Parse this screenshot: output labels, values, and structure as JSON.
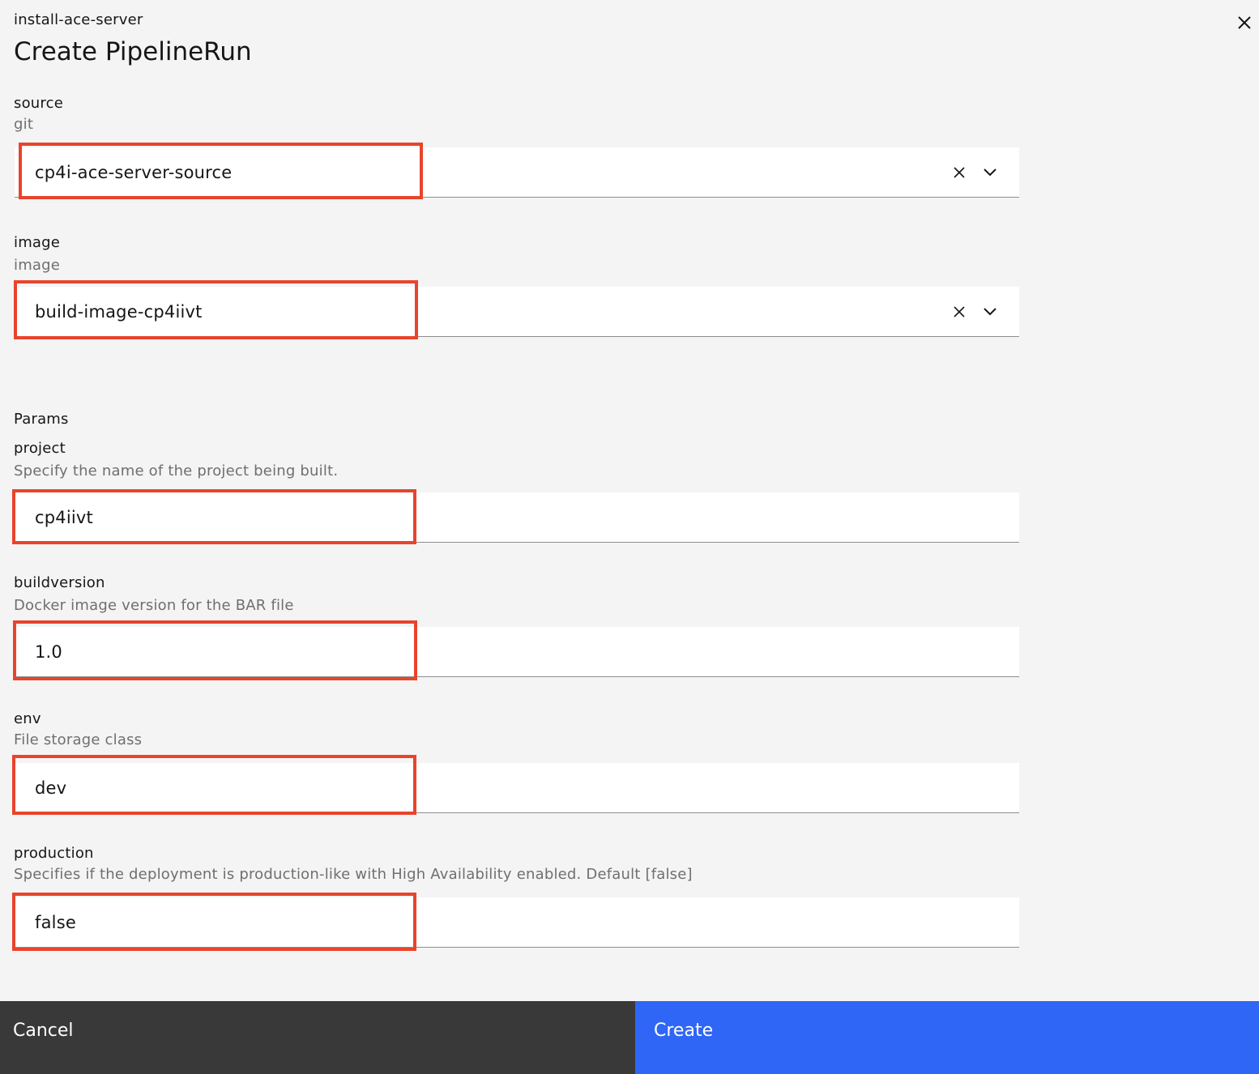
{
  "modal": {
    "label": "install-ace-server",
    "title": "Create PipelineRun"
  },
  "resources": [
    {
      "label": "source",
      "type": "git",
      "value": "cp4i-ace-server-source"
    },
    {
      "label": "image",
      "type": "image",
      "value": "build-image-cp4iivt"
    }
  ],
  "params_heading": "Params",
  "params": [
    {
      "label": "project",
      "help": "Specify the name of the project being built.",
      "value": "cp4iivt"
    },
    {
      "label": "buildversion",
      "help": "Docker image version for the BAR file",
      "value": "1.0"
    },
    {
      "label": "env",
      "help": "File storage class",
      "value": "dev"
    },
    {
      "label": "production",
      "help": "Specifies if the deployment is production-like with High Availability enabled. Default [false]",
      "value": "false"
    }
  ],
  "footer": {
    "cancel_label": "Cancel",
    "create_label": "Create"
  },
  "colors": {
    "highlight": "#e8442c",
    "primary_button": "#2f66f6",
    "secondary_button": "#393939",
    "background": "#f4f4f4"
  }
}
